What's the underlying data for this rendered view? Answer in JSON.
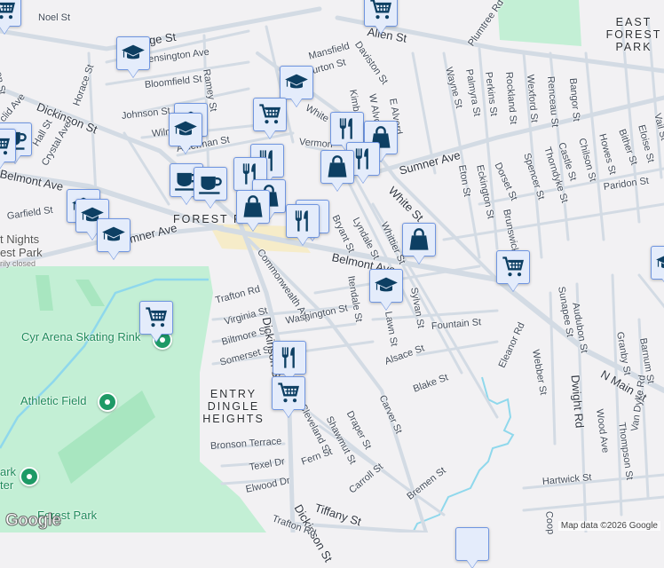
{
  "map": {
    "areas": [
      "FOREST PARK",
      "EAST FOREST PARK",
      "ENTRY DINGLE HEIGHTS"
    ],
    "pois": {
      "skating_rink": "Cyr Arena Skating Rink",
      "athletic_field": "Athletic Field",
      "park_bottom": "Forest Park",
      "bright_nights": "t Nights\nest Park",
      "bright_nights_status": "rily closed",
      "zoo": "ark\nter"
    },
    "streets": [
      "Noel St",
      "ge St",
      "Kensington Ave",
      "Ramey St",
      "Bloomfield St",
      "Horace St",
      "Dickinson St",
      "Johnson St",
      "Wilm",
      "Alderman St",
      "Hall St",
      "Crystal Ave",
      "clid Ave",
      "Belmont Ave",
      "Garfield St",
      "mner Ave",
      "Allen St",
      "Daviston St",
      "Kimberly",
      "W Alvord",
      "E Alvord",
      "Wayne St",
      "Palmyra St",
      "Perkins St",
      "Rockland St",
      "Wexford St",
      "Renceau St",
      "Bangor St",
      "Sumner Ave",
      "Eton St",
      "Eckington St",
      "Dorset St",
      "Spencer St",
      "Thorndyke St",
      "Castle St",
      "Chilson St",
      "Howes St",
      "Bither St",
      "Eloise St",
      "Vail St",
      "Paridon St",
      "White St",
      "Bryant St",
      "Lyndale St",
      "Whittier St",
      "Brunswick St",
      "Belmont Ave",
      "Commonwealth Ave",
      "Trafton Rd",
      "Virginia St",
      "Biltmore St",
      "Washington St",
      "Somerset St",
      "Dickinson St",
      "Itendale St",
      "Sylvan St",
      "Fountain St",
      "Alsace St",
      "Blake St",
      "Carver St",
      "Draper St",
      "Shawmut St",
      "Cleveland St",
      "Bronson Terrace",
      "Texel Dr",
      "Fern St",
      "Elwood Dr",
      "Tiffany St",
      "Dickinson St",
      "Trafton Rd",
      "Carroll St",
      "Bremen St",
      "Eleanor Rd",
      "Webber St",
      "Sunapee St",
      "Audubon St",
      "Dwight Rd",
      "Granby St",
      "Barnum St",
      "N Main St",
      "Wood Ave",
      "Thompson St",
      "Van Dyke Rd",
      "Hartwick St",
      "Coop",
      "Plumtree Rd",
      "Vermon",
      "White",
      "Mansfield",
      "Burton St",
      "Lawn St",
      "on St"
    ],
    "attribution": "Map data ©2026 Google",
    "logo": "Google"
  },
  "colors": {
    "marker_bg": "#e4ecfb",
    "marker_border": "#6f95e0",
    "icon": "#0d3f63",
    "park": "#c3efd5",
    "road": "#d5dde6",
    "water": "#8fd8ec"
  }
}
